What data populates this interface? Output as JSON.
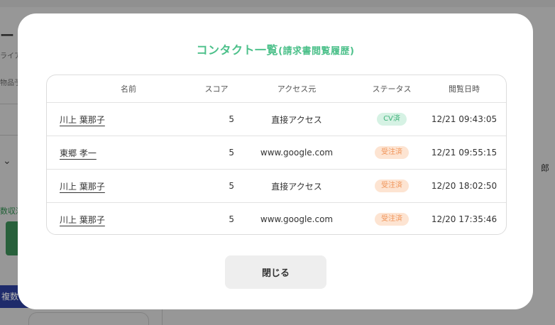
{
  "background": {
    "title": "ート",
    "subtitle": "ライア",
    "subtitle2": "物品予",
    "green_text": "数収済",
    "blue_button": "複数",
    "right_text": "郎"
  },
  "modal": {
    "title_main": "コンタクト一覧",
    "title_sub": "(請求書閲覧履歴)",
    "close_label": "閉じる",
    "colors": {
      "title": "#4cc08a",
      "cv_badge_bg": "#d6f2e4",
      "order_badge_bg": "#fde4d2"
    }
  },
  "table": {
    "headers": {
      "name": "名前",
      "score": "スコア",
      "source": "アクセス元",
      "status": "ステータス",
      "date": "閲覧日時"
    },
    "rows": [
      {
        "name": "川上 葉那子",
        "score": "5",
        "source": "直接アクセス",
        "status": "CV済",
        "date": "12/21 09:43:05"
      },
      {
        "name": "東郷 孝一",
        "score": "5",
        "source": "www.google.com",
        "status": "受注済",
        "date": "12/21 09:55:15"
      },
      {
        "name": "川上 葉那子",
        "score": "5",
        "source": "直接アクセス",
        "status": "受注済",
        "date": "12/20 18:02:50"
      },
      {
        "name": "川上 葉那子",
        "score": "5",
        "source": "www.google.com",
        "status": "受注済",
        "date": "12/20 17:35:46"
      }
    ]
  }
}
